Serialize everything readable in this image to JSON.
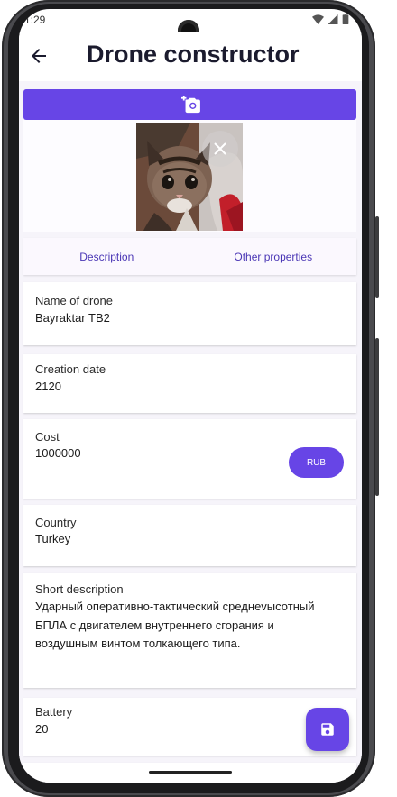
{
  "status_bar": {
    "time": "1:29"
  },
  "app_bar": {
    "title": "Drone constructor",
    "back_icon": "arrow-left-icon"
  },
  "photo": {
    "add_icon": "add-a-photo-icon",
    "remove_icon": "close-icon",
    "image": "kitten-photo"
  },
  "tabs": [
    {
      "label": "Description"
    },
    {
      "label": "Other properties"
    }
  ],
  "fields": {
    "name": {
      "label": "Name of drone",
      "value": "Bayraktar TB2"
    },
    "creation_date": {
      "label": "Creation date",
      "value": "2120"
    },
    "cost": {
      "label": "Cost",
      "value": "1000000",
      "currency": "RUB"
    },
    "country": {
      "label": "Country",
      "value": "Turkey"
    },
    "short_description": {
      "label": "Short description",
      "value": "Ударный оперативно-тактический среднevысотный БПЛА с двигателем внутреннего сгорания и воздушным винтом толкающего типа."
    },
    "battery": {
      "label": "Battery",
      "value": "20"
    }
  },
  "fab": {
    "icon": "save-icon"
  },
  "colors": {
    "accent": "#6745e6",
    "tab_text": "#4a36b5",
    "background": "#f6f4fa"
  }
}
